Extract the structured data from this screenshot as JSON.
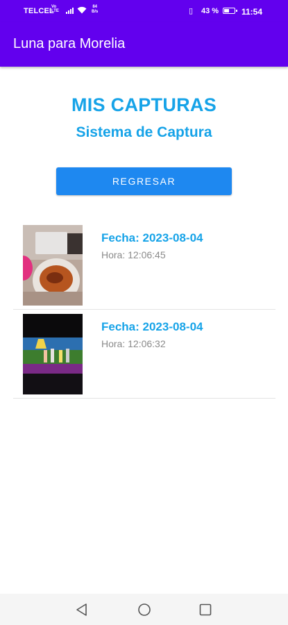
{
  "status_bar": {
    "carrier": "TELCEL",
    "net_small_top": "Vo",
    "net_small_bottom": "LTE",
    "speed_top": "84",
    "speed_bottom": "B/s",
    "battery_percent": "43 %",
    "battery_level": 0.43,
    "time": "11:54"
  },
  "app_bar": {
    "title": "Luna para Morelia"
  },
  "header": {
    "title": "MIS CAPTURAS",
    "subtitle": "Sistema de Captura"
  },
  "back_button": {
    "label": "REGRESAR"
  },
  "captures": [
    {
      "date": "Fecha: 2023-08-04",
      "time": "Hora: 12:06:45",
      "thumbnail": "food-bowl-photo"
    },
    {
      "date": "Fecha: 2023-08-04",
      "time": "Hora: 12:06:32",
      "thumbnail": "tv-screen-photo"
    }
  ],
  "nav_bar": {
    "icons": [
      "back-triangle-icon",
      "home-circle-icon",
      "recents-square-icon"
    ]
  },
  "colors": {
    "app_bar": "#6200ee",
    "accent_text": "#16a3e8",
    "button": "#1e88f0",
    "muted_text": "#8a8a8a"
  }
}
